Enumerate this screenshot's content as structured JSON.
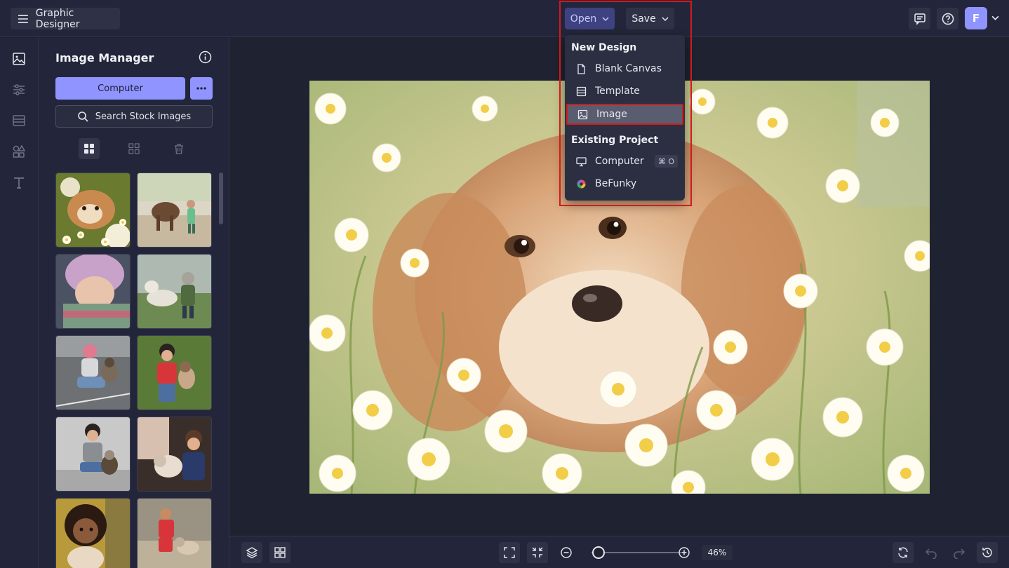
{
  "header": {
    "app_title": "Graphic Designer",
    "open_label": "Open",
    "save_label": "Save",
    "avatar_initial": "F"
  },
  "sidebar_rail": {
    "items": [
      "image-manager-icon",
      "adjust-icon",
      "layouts-icon",
      "graphics-icon",
      "text-icon"
    ]
  },
  "panel": {
    "title": "Image Manager",
    "computer_button": "Computer",
    "more_button": "•••",
    "search_button": "Search Stock Images",
    "thumbnails": [
      "dog-in-daisies",
      "child-with-buffalo",
      "child-in-pink-hat",
      "child-with-husky",
      "girl-with-dog-on-road",
      "girl-with-dog-on-grass",
      "child-with-dog-by-wall",
      "boy-petting-dog",
      "smiling-child-with-dog",
      "boy-with-dog-outdoors"
    ]
  },
  "open_menu": {
    "new_design_heading": "New Design",
    "new_design_items": [
      "Blank Canvas",
      "Template",
      "Image"
    ],
    "existing_project_heading": "Existing Project",
    "existing_items": [
      "Computer",
      "BeFunky"
    ],
    "computer_shortcut": "⌘ O"
  },
  "canvas": {
    "image": "dog-in-daisies-painting"
  },
  "footer": {
    "zoom_value": "46%",
    "zoom_fraction": 0.08
  },
  "colors": {
    "accent": "#8f94ff",
    "highlight_border": "#d21a1a",
    "background": "#1f2230"
  }
}
